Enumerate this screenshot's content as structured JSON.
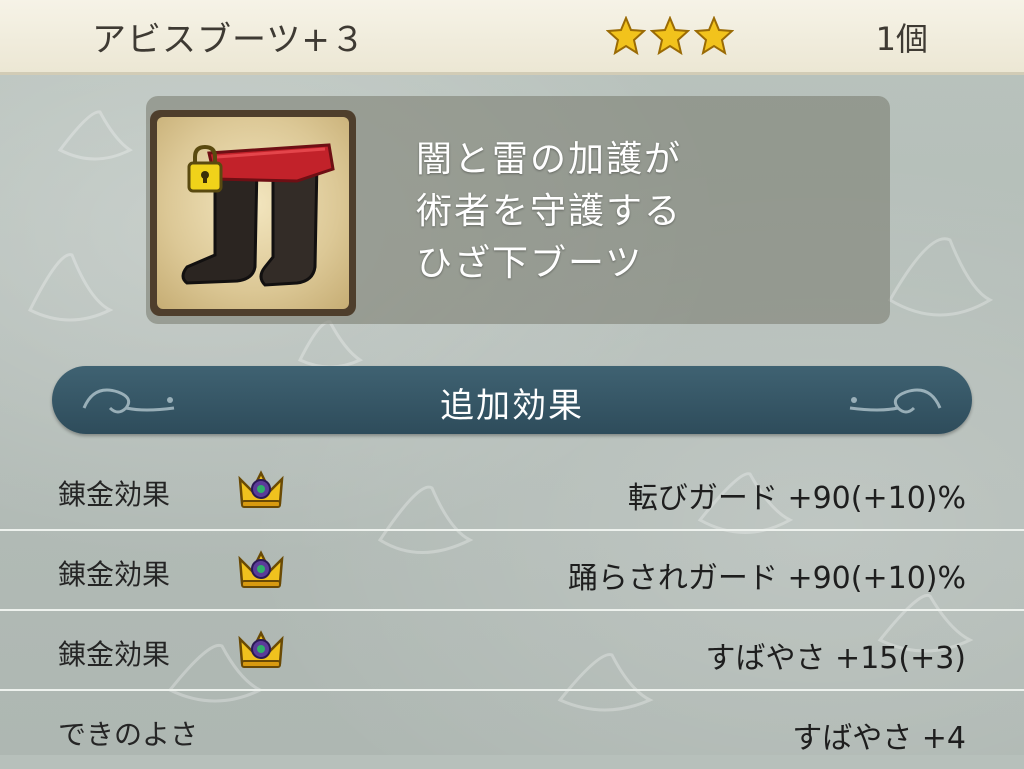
{
  "header": {
    "item_name": "アビスブーツ+３",
    "stars": 3,
    "count": "1個"
  },
  "item": {
    "icon": "boots-icon",
    "locked": true,
    "description": [
      "闇と雷の加護が",
      "術者を守護する",
      "ひざ下ブーツ"
    ]
  },
  "section": {
    "title": "追加効果"
  },
  "effects": [
    {
      "label": "錬金効果",
      "icon": "crown-icon",
      "value": "転びガード +90(+10)%"
    },
    {
      "label": "錬金効果",
      "icon": "crown-icon",
      "value": "踊らされガード +90(+10)%"
    },
    {
      "label": "錬金効果",
      "icon": "crown-icon",
      "value": "すばやさ +15(+3)"
    },
    {
      "label": "できのよさ",
      "icon": null,
      "value": "すばやさ +4"
    }
  ],
  "colors": {
    "header_bg": "#f2eedf",
    "banner_bg": "#36586a",
    "star": "#f2c31c",
    "boot_cuff": "#c2222a"
  }
}
